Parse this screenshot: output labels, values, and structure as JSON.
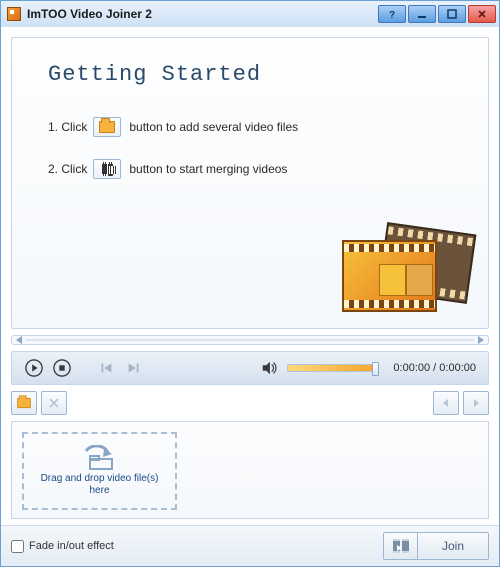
{
  "window": {
    "title": "ImTOO Video Joiner 2"
  },
  "intro": {
    "title": "Getting Started",
    "step1_pre": "1. Click",
    "step1_post": "button to add several video files",
    "step2_pre": "2. Click",
    "step2_post": "button to start merging videos"
  },
  "playback": {
    "time_display": "0:00:00 / 0:00:00"
  },
  "drop": {
    "text": "Drag and drop video file(s) here"
  },
  "bottom": {
    "fade_label": "Fade in/out effect",
    "join_label": "Join"
  }
}
